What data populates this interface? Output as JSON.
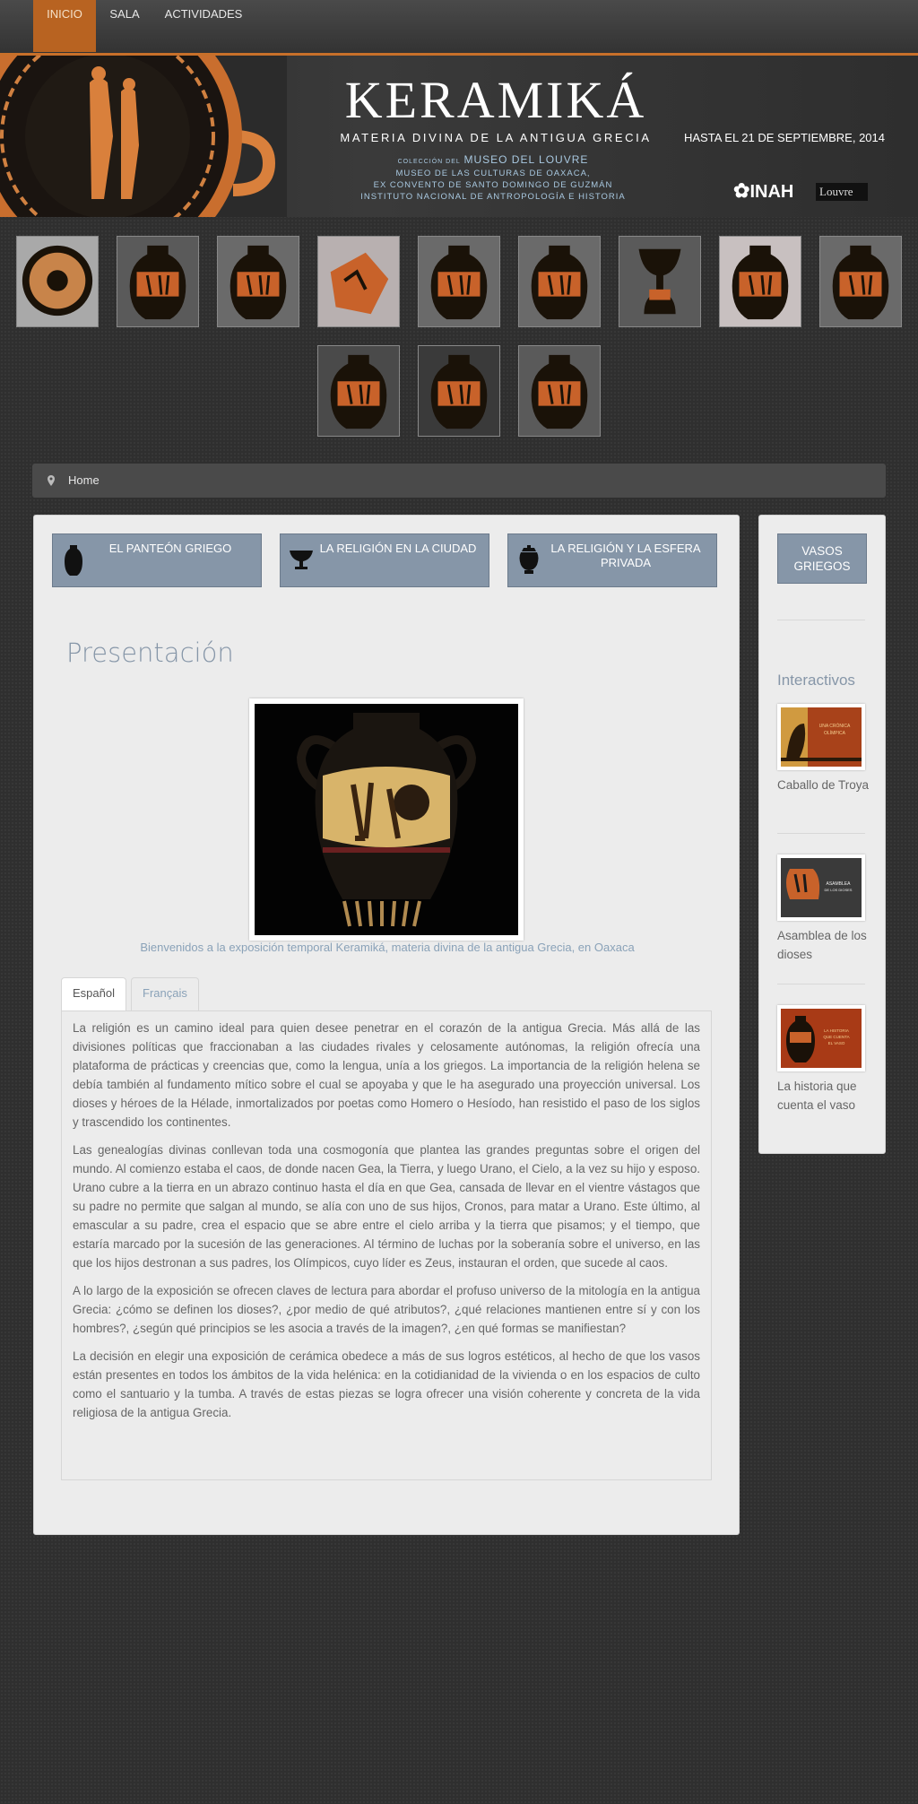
{
  "nav": {
    "items": [
      {
        "label": "INICIO",
        "active": true
      },
      {
        "label": "SALA",
        "active": false
      },
      {
        "label": "ACTIVIDADES",
        "active": false
      }
    ]
  },
  "banner": {
    "title": "KERAMIKÁ",
    "subtitle": "MATERIA DIVINA DE LA ANTIGUA GRECIA",
    "collection_prefix": "COLECCIÓN DEL",
    "collection_museum": "MUSEO DEL LOUVRE",
    "venue_line1": "MUSEO DE LAS CULTURAS DE OAXACA,",
    "venue_line2": "EX CONVENTO DE SANTO DOMINGO DE GUZMÁN",
    "venue_line3": "INSTITUTO NACIONAL DE ANTROPOLOGÍA E HISTORIA",
    "date": "HASTA EL 21 DE SEPTIEMBRE, 2014",
    "logo_inah": "INAH",
    "logo_louvre": "Louvre"
  },
  "breadcrumb": {
    "label": "Home"
  },
  "categories": [
    {
      "label": "EL PANTEÓN GRIEGO",
      "icon": "amphora-icon"
    },
    {
      "label": "LA RELIGIÓN EN LA CIUDAD",
      "icon": "kylix-icon"
    },
    {
      "label": "LA RELIGIÓN Y LA ESFERA PRIVADA",
      "icon": "lidded-vase-icon"
    }
  ],
  "main": {
    "title": "Presentación",
    "caption": "Bienvenidos a la exposición temporal Keramiká, materia divina de la antigua Grecia, en Oaxaca",
    "tabs": [
      {
        "label": "Español",
        "active": true
      },
      {
        "label": "Français",
        "active": false
      }
    ],
    "paragraphs": [
      "La religión es un camino ideal para quien desee penetrar en el corazón de la antigua Grecia.  Más allá de las divisiones políticas que fraccionaban a las ciudades rivales y celosamente autónomas, la religión ofrecía una plataforma de prácticas y creencias que, como la lengua, unía a los griegos.  La importancia de la religión helena se debía también al fundamento mítico sobre el cual se apoyaba y que le ha asegurado una proyección universal. Los dioses y héroes de la Hélade, inmortalizados por poetas como Homero o Hesíodo, han resistido el paso de los siglos y trascendido los continentes.",
      "Las genealogías divinas conllevan toda una cosmogonía que plantea las grandes preguntas sobre el origen del mundo. Al comienzo estaba el caos, de donde nacen Gea, la Tierra, y luego Urano, el Cielo, a la vez su hijo y esposo. Urano cubre a la tierra en un abrazo continuo hasta el día en que Gea, cansada de llevar en el vientre vástagos que su padre no permite que salgan al mundo, se alía con uno de sus hijos, Cronos, para matar a Urano. Este último, al emascular a su padre, crea el espacio que se abre entre el cielo arriba y la tierra que pisamos; y el tiempo, que estaría marcado por la sucesión de las generaciones.  Al término de luchas por la soberanía sobre el universo, en  las que los hijos destronan a sus padres, los Olímpicos, cuyo líder es Zeus, instauran el orden, que sucede al caos.",
      "A lo largo de la exposición se ofrecen claves de lectura para abordar el profuso universo de la mitología en la antigua Grecia: ¿cómo se definen los dioses?, ¿por medio de qué atributos?, ¿qué relaciones mantienen entre sí y con los hombres?, ¿según qué principios se les asocia a través de la imagen?, ¿en qué formas se manifiestan?",
      "La decisión en elegir una exposición de cerámica obedece a más de sus logros estéticos, al hecho de que los vasos están presentes en todos los ámbitos de la vida helénica: en la cotidianidad de la vivienda o en los espacios de culto como el santuario y la tumba. A través de estas piezas se logra ofrecer una visión coherente y concreta de la vida religiosa de la antigua Grecia."
    ]
  },
  "sidebar": {
    "button": "VASOS GRIEGOS",
    "heading": "Interactivos",
    "items": [
      {
        "label": "Caballo de Troya",
        "image_text": "UNA CRÓNICA OLÍMPICA: EL CABALLO DE TROYA"
      },
      {
        "label": "Asamblea de los dioses",
        "image_text": "ASAMBLEA DE LOS DIOSES"
      },
      {
        "label": "La historia que cuenta el vaso",
        "image_text": "LA HISTORIA QUE CUENTA EL VASO"
      }
    ]
  },
  "colors": {
    "accent": "#b86321",
    "nav_bg": "#3d3d3d",
    "category_btn": "#8696a8",
    "title_blue": "#8696a8",
    "caption_blue": "#8aa2b8",
    "panel_bg": "#ececec"
  }
}
